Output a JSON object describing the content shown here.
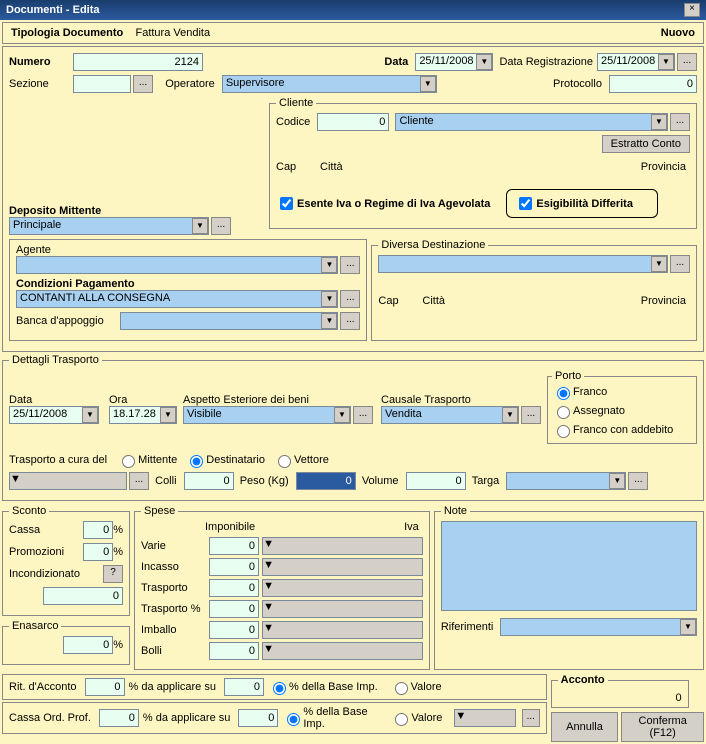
{
  "window": {
    "title": "Documenti - Edita"
  },
  "header": {
    "tipologia_label": "Tipologia Documento",
    "tipologia_value": "Fattura Vendita",
    "status": "Nuovo"
  },
  "top": {
    "numero_label": "Numero",
    "numero": "2124",
    "data_label": "Data",
    "data": "25/11/2008",
    "data_reg_label": "Data Registrazione",
    "data_reg": "25/11/2008",
    "sezione_label": "Sezione",
    "sezione": "",
    "operatore_label": "Operatore",
    "operatore": "Supervisore",
    "protocollo_label": "Protocollo",
    "protocollo": "0"
  },
  "cliente": {
    "legend": "Cliente",
    "codice_label": "Codice",
    "codice": "0",
    "tipo": "Cliente",
    "cap_label": "Cap",
    "citta_label": "Città",
    "provincia_label": "Provincia",
    "estratto_conto": "Estratto Conto",
    "esente_label": "Esente Iva o Regime di Iva Agevolata",
    "esigibilita_label": "Esigibilità Differita"
  },
  "deposito": {
    "label": "Deposito Mittente",
    "value": "Principale"
  },
  "agente": {
    "label": "Agente",
    "value": ""
  },
  "condizioni": {
    "label": "Condizioni Pagamento",
    "value": "CONTANTI ALLA CONSEGNA"
  },
  "banca": {
    "label": "Banca d'appoggio",
    "value": ""
  },
  "diversa": {
    "legend": "Diversa Destinazione",
    "value": "",
    "cap_label": "Cap",
    "citta_label": "Città",
    "provincia_label": "Provincia"
  },
  "trasporto": {
    "legend": "Dettagli Trasporto",
    "data_label": "Data",
    "data": "25/11/2008",
    "ora_label": "Ora",
    "ora": "18.17.28",
    "aspetto_label": "Aspetto Esteriore dei beni",
    "aspetto": "Visibile",
    "causale_label": "Causale Trasporto",
    "causale": "Vendita",
    "porto_legend": "Porto",
    "porto_opts": {
      "franco": "Franco",
      "assegnato": "Assegnato",
      "franco_add": "Franco con addebito"
    },
    "cura_label": "Trasporto a cura del",
    "cura_opts": {
      "mittente": "Mittente",
      "destinatario": "Destinatario",
      "vettore": "Vettore"
    },
    "colli_label": "Colli",
    "colli": "0",
    "peso_label": "Peso (Kg)",
    "peso": "0",
    "volume_label": "Volume",
    "volume": "0",
    "targa_label": "Targa",
    "targa": ""
  },
  "sconto": {
    "legend": "Sconto",
    "cassa_label": "Cassa",
    "cassa": "0",
    "promo_label": "Promozioni",
    "promo": "0",
    "incond_label": "Incondizionato",
    "incond": "0",
    "pct": "%"
  },
  "enasarco": {
    "legend": "Enasarco",
    "value": "0",
    "pct": "%"
  },
  "spese": {
    "legend": "Spese",
    "imponibile_label": "Imponibile",
    "iva_label": "Iva",
    "rows": [
      {
        "label": "Varie",
        "imp": "0"
      },
      {
        "label": "Incasso",
        "imp": "0"
      },
      {
        "label": "Trasporto",
        "imp": "0"
      },
      {
        "label": "Trasporto %",
        "imp": "0"
      },
      {
        "label": "Imballo",
        "imp": "0"
      },
      {
        "label": "Bolli",
        "imp": "0"
      }
    ]
  },
  "note": {
    "legend": "Note",
    "value": "",
    "rif_label": "Riferimenti",
    "rif": ""
  },
  "rit": {
    "label": "Rit. d'Acconto",
    "val1": "0",
    "applicare": "% da applicare su",
    "val2": "0",
    "base_imp": "% della Base Imp.",
    "valore": "Valore"
  },
  "cassa_ord": {
    "label": "Cassa Ord. Prof.",
    "val1": "0",
    "applicare": "% da applicare su",
    "val2": "0",
    "base_imp": "% della Base Imp.",
    "valore": "Valore"
  },
  "acconto": {
    "legend": "Acconto",
    "value": "0"
  },
  "buttons": {
    "annulla": "Annulla",
    "conferma": "Conferma (F12)",
    "dots": "...",
    "q": "?"
  }
}
